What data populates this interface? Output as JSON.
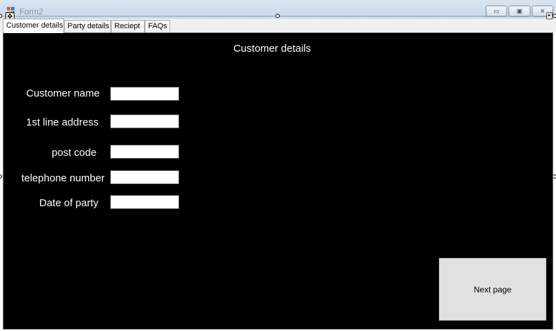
{
  "window": {
    "title": "Form2",
    "minimize_glyph": "▭",
    "maximize_glyph": "▣",
    "close_glyph": "✕",
    "move_glyph": "✥",
    "scroll_glyph": "▸"
  },
  "tabs": [
    {
      "label": "Customer details",
      "active": true
    },
    {
      "label": "Party details",
      "active": false
    },
    {
      "label": "Reciept",
      "active": false
    },
    {
      "label": "FAQs",
      "active": false
    }
  ],
  "page": {
    "heading": "Customer details",
    "background": "#000000",
    "text_color": "#ffffff"
  },
  "form": {
    "fields": [
      {
        "label": "Customer name",
        "value": ""
      },
      {
        "label": "1st line address",
        "value": ""
      },
      {
        "label": "post code",
        "value": ""
      },
      {
        "label": "telephone number",
        "value": ""
      },
      {
        "label": "Date of party",
        "value": ""
      }
    ]
  },
  "next_button": {
    "label": "Next page"
  }
}
